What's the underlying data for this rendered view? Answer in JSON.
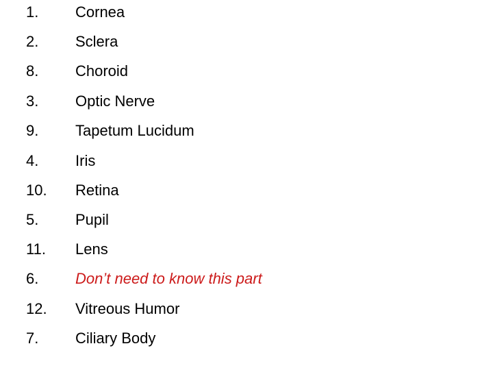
{
  "items": [
    {
      "number": "1.",
      "label": "Cornea"
    },
    {
      "number": "2.",
      "label": "Sclera"
    },
    {
      "number": "8.",
      "label": "Choroid"
    },
    {
      "number": "3.",
      "label": "Optic Nerve"
    },
    {
      "number": "9.",
      "label": "Tapetum Lucidum"
    },
    {
      "number": "4.",
      "label": "Iris"
    },
    {
      "number": "10.",
      "label": "Retina"
    },
    {
      "number": "5.",
      "label": "Pupil"
    },
    {
      "number": "11.",
      "label": "Lens"
    },
    {
      "number": "6.",
      "label": "Don’t need to know this part",
      "note": true,
      "color": "#cc1a1a"
    },
    {
      "number": "12.",
      "label": "Vitreous Humor"
    },
    {
      "number": "7.",
      "label": "Ciliary Body"
    }
  ]
}
